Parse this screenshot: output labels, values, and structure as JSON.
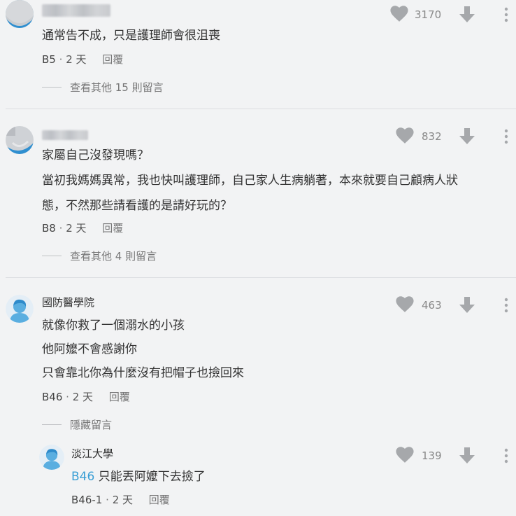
{
  "colors": {
    "background": "#f2f3f4",
    "icon_gray": "#a6a8ab",
    "link_blue": "#3a9fd5",
    "avatar_blue": "#5aaee0"
  },
  "comments": [
    {
      "author": "",
      "author_blurred": true,
      "lines": [
        "通常告不成，只是護理師會很沮喪"
      ],
      "floor": "B5",
      "separator": "·",
      "time": "2 天",
      "reply_label": "回覆",
      "likes": "3170",
      "expand_label": "查看其他 15 則留言"
    },
    {
      "author": "",
      "author_blurred": true,
      "lines": [
        "家屬自己沒發現嗎？",
        "當初我媽媽異常，我也快叫護理師，自己家人生病躺著，本來就要自己顧病人狀",
        "態，不然那些請看護的是請好玩的？"
      ],
      "floor": "B8",
      "separator": "·",
      "time": "2 天",
      "reply_label": "回覆",
      "likes": "832",
      "expand_label": "查看其他 4 則留言"
    },
    {
      "author": "國防醫學院",
      "author_blurred": false,
      "lines": [
        "就像你救了一個溺水的小孩",
        "他阿嬤不會感謝你",
        "只會靠北你為什麼沒有把帽子也撿回來"
      ],
      "floor": "B46",
      "separator": "·",
      "time": "2 天",
      "reply_label": "回覆",
      "likes": "463",
      "expand_label": "隱藏留言"
    }
  ],
  "reply": {
    "author": "淡江大學",
    "tag": "B46",
    "text": "只能丟阿嬤下去撿了",
    "floor": "B46-1",
    "separator": "·",
    "time": "2 天",
    "reply_label": "回覆",
    "likes": "139"
  },
  "icons": {
    "like": "heart-icon",
    "dislike": "down-arrow-icon",
    "more": "more-vertical-icon",
    "avatar": "person-avatar-icon"
  }
}
